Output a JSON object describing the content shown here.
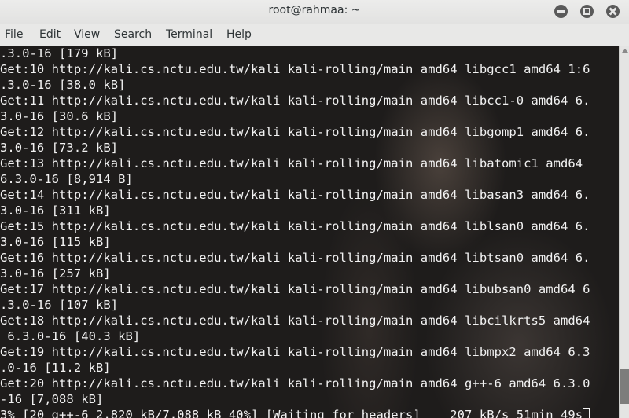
{
  "window": {
    "title": "root@rahmaa: ~",
    "controls": [
      "minimize",
      "maximize",
      "close"
    ]
  },
  "menubar": {
    "items": [
      {
        "label": "File"
      },
      {
        "label": "Edit"
      },
      {
        "label": "View"
      },
      {
        "label": "Search"
      },
      {
        "label": "Terminal"
      },
      {
        "label": "Help"
      }
    ]
  },
  "terminal": {
    "lines": [
      ".3.0-16 [179 kB]",
      "Get:10 http://kali.cs.nctu.edu.tw/kali kali-rolling/main amd64 libgcc1 amd64 1:6",
      ".3.0-16 [38.0 kB]",
      "Get:11 http://kali.cs.nctu.edu.tw/kali kali-rolling/main amd64 libcc1-0 amd64 6.",
      "3.0-16 [30.6 kB]",
      "Get:12 http://kali.cs.nctu.edu.tw/kali kali-rolling/main amd64 libgomp1 amd64 6.",
      "3.0-16 [73.2 kB]",
      "Get:13 http://kali.cs.nctu.edu.tw/kali kali-rolling/main amd64 libatomic1 amd64",
      "6.3.0-16 [8,914 B]",
      "Get:14 http://kali.cs.nctu.edu.tw/kali kali-rolling/main amd64 libasan3 amd64 6.",
      "3.0-16 [311 kB]",
      "Get:15 http://kali.cs.nctu.edu.tw/kali kali-rolling/main amd64 liblsan0 amd64 6.",
      "3.0-16 [115 kB]",
      "Get:16 http://kali.cs.nctu.edu.tw/kali kali-rolling/main amd64 libtsan0 amd64 6.",
      "3.0-16 [257 kB]",
      "Get:17 http://kali.cs.nctu.edu.tw/kali kali-rolling/main amd64 libubsan0 amd64 6",
      ".3.0-16 [107 kB]",
      "Get:18 http://kali.cs.nctu.edu.tw/kali kali-rolling/main amd64 libcilkrts5 amd64",
      " 6.3.0-16 [40.3 kB]",
      "Get:19 http://kali.cs.nctu.edu.tw/kali kali-rolling/main amd64 libmpx2 amd64 6.3",
      ".0-16 [11.2 kB]",
      "Get:20 http://kali.cs.nctu.edu.tw/kali kali-rolling/main amd64 g++-6 amd64 6.3.0",
      "-16 [7,088 kB]",
      "3% [20 g++-6 2,820 kB/7,088 kB 40%] [Waiting for headers]    207 kB/s 51min 49s"
    ]
  },
  "scrollbar": {
    "position_fraction": 0.95
  }
}
